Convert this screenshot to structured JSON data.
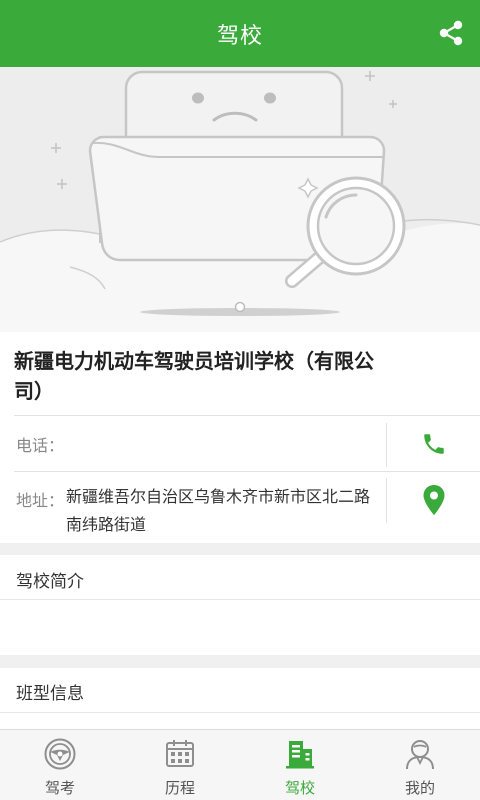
{
  "header": {
    "title": "驾校"
  },
  "school": {
    "name": "新疆电力机动车驾驶员培训学校（有限公司）",
    "phone_label": "电话：",
    "phone_value": "",
    "address_label": "地址：",
    "address_value": "新疆维吾尔自治区乌鲁木齐市新市区北二路南纬路街道"
  },
  "sections": {
    "intro_title": "驾校简介",
    "class_title": "班型信息"
  },
  "tabs": [
    {
      "label": "驾考",
      "icon": "steering-wheel-icon"
    },
    {
      "label": "历程",
      "icon": "calendar-icon"
    },
    {
      "label": "驾校",
      "icon": "school-building-icon"
    },
    {
      "label": "我的",
      "icon": "user-profile-icon"
    }
  ],
  "colors": {
    "brand": "#3aaa3a",
    "icon_gray": "#8e8e8e"
  }
}
